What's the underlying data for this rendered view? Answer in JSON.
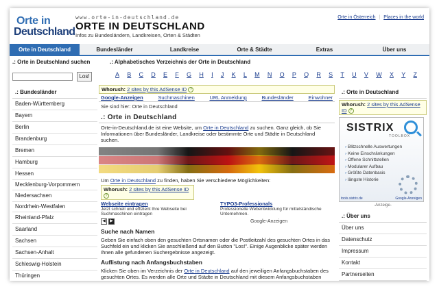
{
  "header": {
    "logo_line1": "Orte in",
    "logo_line2": "Deutschland",
    "site_url": "www.orte-in-deutschland.de",
    "site_title": "ORTE IN DEUTSCHLAND",
    "site_subtitle": "Infos zu Bundesländern, Landkreisen, Orten & Städten",
    "top_links": [
      "Orte in Österreich",
      "Places in the world"
    ]
  },
  "nav": {
    "items": [
      "Orte in Deutschland",
      "Bundesländer",
      "Landkreise",
      "Orte & Städte",
      "Extras",
      "Über uns"
    ],
    "active_index": 0
  },
  "search": {
    "heading": ".: Orte in Deutschland suchen",
    "value": "",
    "button_label": "Los!"
  },
  "alphabet": {
    "heading": ".: Alphabetisches Verzeichnis der Orte in Deutschland",
    "letters": [
      "A",
      "B",
      "C",
      "D",
      "E",
      "F",
      "G",
      "H",
      "I",
      "J",
      "K",
      "L",
      "M",
      "N",
      "O",
      "P",
      "Q",
      "R",
      "S",
      "T",
      "U",
      "V",
      "W",
      "X",
      "Y",
      "Z"
    ]
  },
  "left_sidebar": {
    "heading": ".: Bundesländer",
    "items": [
      "Baden-Württemberg",
      "Bayern",
      "Berlin",
      "Brandenburg",
      "Bremen",
      "Hamburg",
      "Hessen",
      "Mecklenburg-Vorpommern",
      "Niedersachsen",
      "Nordrhein-Westfalen",
      "Rheinland-Pfalz",
      "Saarland",
      "Sachsen",
      "Sachsen-Anhalt",
      "Schleswig-Holstein",
      "Thüringen"
    ]
  },
  "main": {
    "ad_label": "Whorush:",
    "ad_link": "2 sites by this AdSense ID",
    "ad_links": [
      "Google-Anzeigen",
      "Suchmaschinen",
      "URL Anmeldung",
      "Bundesländer",
      "Einwohner"
    ],
    "breadcrumb": "Sie sind hier: Orte in Deutschland",
    "heading": ".: Orte in Deutschland",
    "intro_before": "Orte-in-Deutschland.de ist eine Website, um ",
    "intro_link": "Orte in Deutschland",
    "intro_after": " zu suchen. Ganz gleich, ob Sie Informationen über Bundesländer, Landkreise oder bestimmte Orte und Städte in Deutschland suchen.",
    "find_link": "Orte in Deutschland",
    "find_before": "Um ",
    "find_after": " zu finden, haben Sie verschiedene Möglichkeiten:",
    "ad2_label": "Whorush:",
    "ad2_link": "2 sites by this AdSense ID",
    "ads": [
      {
        "title": "Webseite eintragen",
        "text": "Jetzt schnell und effizient Ihre Webseite bei Suchmaschinen eintragen"
      },
      {
        "title": "TYPO3-Professionals",
        "text": "Professionelle Webentwicklung für mittelständische Unternehmen."
      }
    ],
    "google_ads_label": "Google-Anzeigen",
    "section1_title": "Suche nach Namen",
    "section1_text": "Geben Sie einfach oben den gesuchten Ortsnamen oder die Postleitzahl des gesuchten Ortes in das Suchfeld ein und klicken Sie anschließend auf den Button \"Los!\". Einige Augenblicke später werden Ihnen alle gefundenen Suchergebnisse angezeigt.",
    "section2_title": "Auflistung nach Anfangsbuchstaben",
    "section2_before": "Klicken Sie oben im Verzeichnis der ",
    "section2_link": "Orte in Deutschland",
    "section2_after": " auf den jeweiligen Anfangsbuchstaben des gesuchten Ortes. Es werden alle Orte und Städte in Deutschland mit diesem Anfangsbuchstaben alphabetisch sortiert angezeigt."
  },
  "right_sidebar": {
    "heading": ".: Orte in Deutschland",
    "ad_label": "Whorush:",
    "ad_link": "2 sites by this AdSense ID",
    "sistrix": {
      "logo": "SISTRIX",
      "toolbox": "TOOLBOX",
      "features": [
        "Blitzschnelle Auswertungen",
        "Keine Einschränkungen",
        "Offene Schnittstellen",
        "Modularer Aufbau",
        "Größte Datenbasis",
        "längste Historie"
      ],
      "footer_left": "tools.sistrix.de",
      "footer_right": "Google-Anzeigen"
    },
    "anzeige": "-Anzeige-",
    "heading2": ".: Über uns",
    "links": [
      "Über uns",
      "Datenschutz",
      "Impressum",
      "Kontakt",
      "Partnerseiten"
    ]
  },
  "colors": {
    "accent": "#2f6db3",
    "link": "#1a3c8e",
    "ad_background": "#ffffe6"
  }
}
